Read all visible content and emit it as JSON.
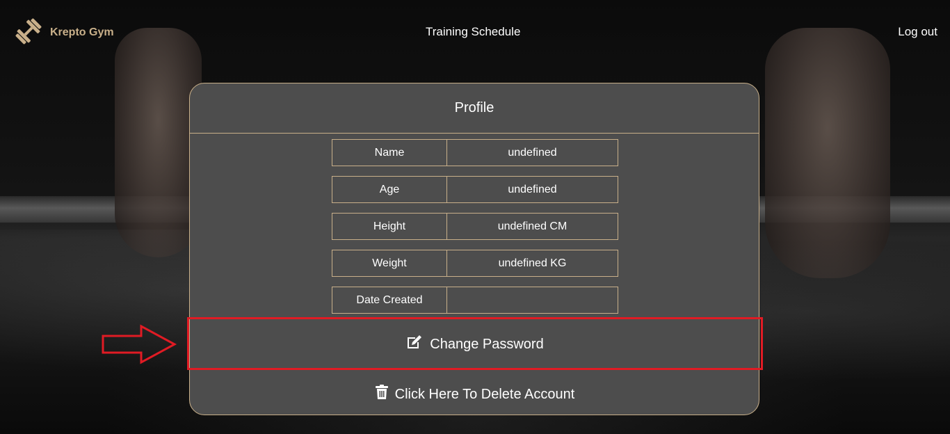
{
  "nav": {
    "brand": "Krepto Gym",
    "links": [
      {
        "label": "Training Schedule"
      },
      {
        "label": "Log out"
      }
    ]
  },
  "profile": {
    "title": "Profile",
    "rows": [
      {
        "label": "Name",
        "value": "undefined"
      },
      {
        "label": "Age",
        "value": "undefined"
      },
      {
        "label": "Height",
        "value": "undefined CM"
      },
      {
        "label": "Weight",
        "value": "undefined KG"
      },
      {
        "label": "Date Created",
        "value": ""
      }
    ],
    "actions": {
      "change_password": "Change Password",
      "delete_account": "Click Here To Delete Account"
    }
  },
  "icons": {
    "brand": "dumbbell-icon",
    "change_password": "edit-icon",
    "delete_account": "trash-icon"
  },
  "colors": {
    "accent": "#c9b08a",
    "card": "#4d4d4d",
    "highlight": "#e01b24"
  }
}
